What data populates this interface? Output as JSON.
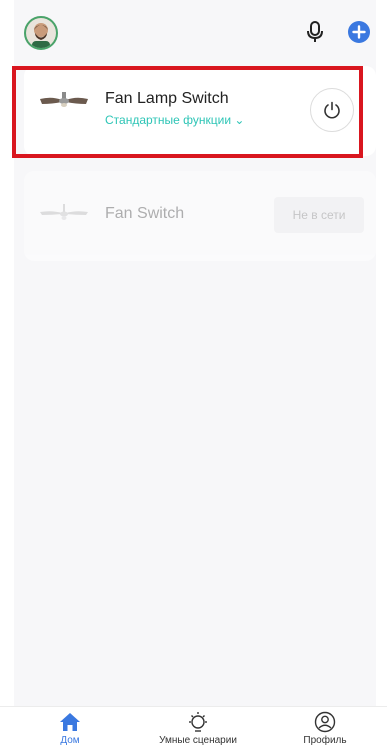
{
  "header": {
    "avatar_icon": "user-avatar",
    "mic_icon": "microphone-icon",
    "add_icon": "plus-circle-icon",
    "accent": "#3a78e0"
  },
  "devices": [
    {
      "name": "Fan Lamp Switch",
      "subtitle": "Стандартные функции ⌄",
      "icon": "ceiling-fan-icon",
      "action_icon": "power-icon",
      "status": "online"
    },
    {
      "name": "Fan Switch",
      "icon": "ceiling-fan-icon",
      "status_label": "Не в сети",
      "status": "offline"
    }
  ],
  "nav": {
    "home": "Дом",
    "scenes": "Умные сценарии",
    "profile": "Профиль",
    "active": "home"
  },
  "colors": {
    "subtitle": "#2ec5b6",
    "highlight": "#d9161f",
    "active_nav": "#3a78e0"
  }
}
